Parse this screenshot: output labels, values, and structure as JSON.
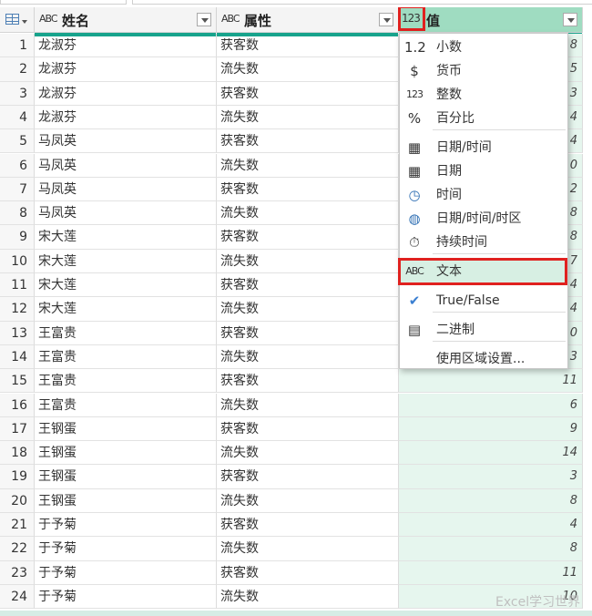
{
  "columns": {
    "name": {
      "type_icon": "ABC",
      "title": "姓名"
    },
    "attr": {
      "type_icon": "ABC",
      "title": "属性"
    },
    "value": {
      "type_icon": "123",
      "title": "值"
    }
  },
  "rows": [
    {
      "n": "1",
      "name": "龙淑芬",
      "attr": "获客数",
      "val": "8"
    },
    {
      "n": "2",
      "name": "龙淑芬",
      "attr": "流失数",
      "val": "5"
    },
    {
      "n": "3",
      "name": "龙淑芬",
      "attr": "获客数",
      "val": "13"
    },
    {
      "n": "4",
      "name": "龙淑芬",
      "attr": "流失数",
      "val": "4"
    },
    {
      "n": "5",
      "name": "马凤英",
      "attr": "获客数",
      "val": "4"
    },
    {
      "n": "6",
      "name": "马凤英",
      "attr": "流失数",
      "val": "0"
    },
    {
      "n": "7",
      "name": "马凤英",
      "attr": "获客数",
      "val": "12"
    },
    {
      "n": "8",
      "name": "马凤英",
      "attr": "流失数",
      "val": "8"
    },
    {
      "n": "9",
      "name": "宋大莲",
      "attr": "获客数",
      "val": "8"
    },
    {
      "n": "10",
      "name": "宋大莲",
      "attr": "流失数",
      "val": "17"
    },
    {
      "n": "11",
      "name": "宋大莲",
      "attr": "获客数",
      "val": "4"
    },
    {
      "n": "12",
      "name": "宋大莲",
      "attr": "流失数",
      "val": "4"
    },
    {
      "n": "13",
      "name": "王富贵",
      "attr": "获客数",
      "val": "0"
    },
    {
      "n": "14",
      "name": "王富贵",
      "attr": "流失数",
      "val": "3"
    },
    {
      "n": "15",
      "name": "王富贵",
      "attr": "获客数",
      "val": "11"
    },
    {
      "n": "16",
      "name": "王富贵",
      "attr": "流失数",
      "val": "6"
    },
    {
      "n": "17",
      "name": "王钢蛋",
      "attr": "获客数",
      "val": "9"
    },
    {
      "n": "18",
      "name": "王钢蛋",
      "attr": "流失数",
      "val": "14"
    },
    {
      "n": "19",
      "name": "王钢蛋",
      "attr": "获客数",
      "val": "3"
    },
    {
      "n": "20",
      "name": "王钢蛋",
      "attr": "流失数",
      "val": "8"
    },
    {
      "n": "21",
      "name": "于予菊",
      "attr": "获客数",
      "val": "4"
    },
    {
      "n": "22",
      "name": "于予菊",
      "attr": "流失数",
      "val": "8"
    },
    {
      "n": "23",
      "name": "于予菊",
      "attr": "获客数",
      "val": "11"
    },
    {
      "n": "24",
      "name": "于予菊",
      "attr": "流失数",
      "val": "10"
    }
  ],
  "menu": {
    "items": [
      {
        "icon": "1.2",
        "label": "小数",
        "icon_name": "decimal-icon"
      },
      {
        "icon": "$",
        "label": "货币",
        "icon_name": "currency-icon"
      },
      {
        "icon": "123",
        "label": "整数",
        "icon_name": "whole-number-icon"
      },
      {
        "icon": "%",
        "label": "百分比",
        "icon_name": "percent-icon"
      },
      {
        "icon": "▦",
        "label": "日期/时间",
        "icon_name": "datetime-icon"
      },
      {
        "icon": "▦",
        "label": "日期",
        "icon_name": "date-icon"
      },
      {
        "icon": "◷",
        "label": "时间",
        "icon_name": "time-icon"
      },
      {
        "icon": "◍",
        "label": "日期/时间/时区",
        "icon_name": "datetimezone-icon"
      },
      {
        "icon": "⏱",
        "label": "持续时间",
        "icon_name": "duration-icon"
      },
      {
        "icon": "ABC",
        "label": "文本",
        "icon_name": "text-icon"
      },
      {
        "icon": "✔",
        "label": "True/False",
        "icon_name": "true-false-icon"
      },
      {
        "icon": "▤",
        "label": "二进制",
        "icon_name": "binary-icon"
      },
      {
        "icon": "",
        "label": "使用区域设置...",
        "icon_name": "locale-icon"
      }
    ]
  },
  "watermark": "Excel学习世界",
  "colors": {
    "accent": "#17a38c",
    "selected_column": "#9fdcc1",
    "highlight": "#e0211f"
  }
}
